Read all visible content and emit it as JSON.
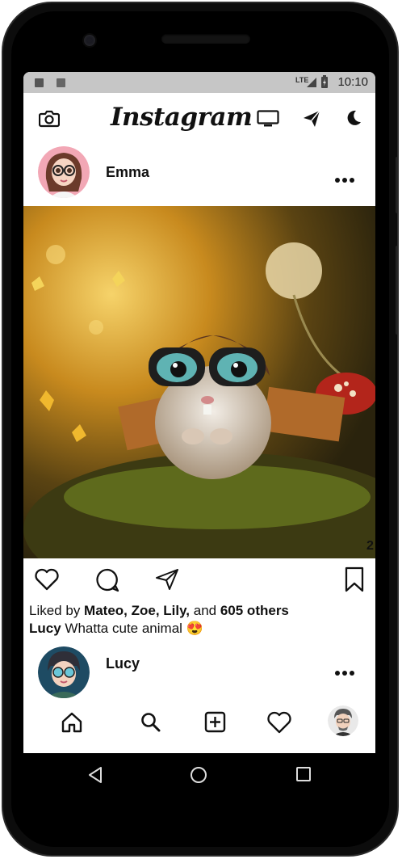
{
  "status_bar": {
    "time": "10:10",
    "network": "LTE"
  },
  "header": {
    "logo": "Instagram",
    "icons": [
      "camera-icon",
      "tv-icon",
      "send-icon",
      "moon-icon"
    ]
  },
  "post": {
    "username": "Emma",
    "image_alt": "cute hamster aviator",
    "likes_prefix": "Liked by ",
    "liked_by_names": "Mateo, Zoe, Lily,",
    "likes_middle": " and ",
    "likes_count": "605 others",
    "caption_user": "Lucy",
    "caption_text": " Whatta cute animal 😍"
  },
  "next_post": {
    "username": "Lucy"
  },
  "bottom_nav": [
    "home-icon",
    "search-icon",
    "add-post-icon",
    "heart-icon",
    "profile-avatar"
  ],
  "colors": {
    "accent": "#111111",
    "status_bar": "#c6c6c6",
    "phone_body": "#0c0c0c"
  }
}
